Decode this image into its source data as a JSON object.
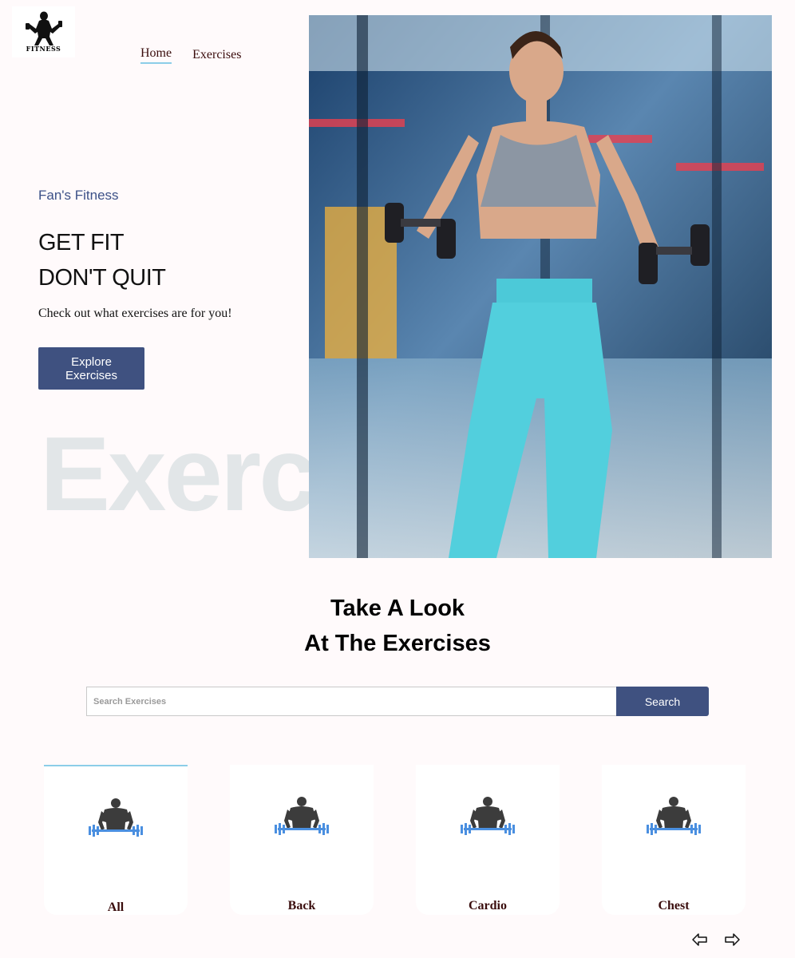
{
  "logo": {
    "text": "FITNESS",
    "icon": "fitness-silhouette-logo"
  },
  "nav": {
    "home": "Home",
    "exercises": "Exercises"
  },
  "hero": {
    "brand": "Fan's Fitness",
    "title_line1": "GET FIT",
    "title_line2": "DON'T QUIT",
    "subtitle": "Check out what exercises are for you!",
    "button": "Explore Exercises",
    "watermark": "Exercise",
    "image": "woman-lifting-dumbbells-photo"
  },
  "section": {
    "title_line1": "Take A Look",
    "title_line2": "At The Exercises"
  },
  "search": {
    "placeholder": "Search Exercises",
    "button": "Search"
  },
  "categories": [
    {
      "label": "All",
      "icon": "gym-icon"
    },
    {
      "label": "Back",
      "icon": "gym-icon"
    },
    {
      "label": "Cardio",
      "icon": "gym-icon"
    },
    {
      "label": "Chest",
      "icon": "gym-icon"
    }
  ],
  "arrows": {
    "left": "left-arrow-icon",
    "right": "right-arrow-icon"
  },
  "colors": {
    "accent": "#3f5180",
    "underline": "#8ccde8",
    "background": "#fffafb",
    "text_dark": "#3a0d0d"
  }
}
